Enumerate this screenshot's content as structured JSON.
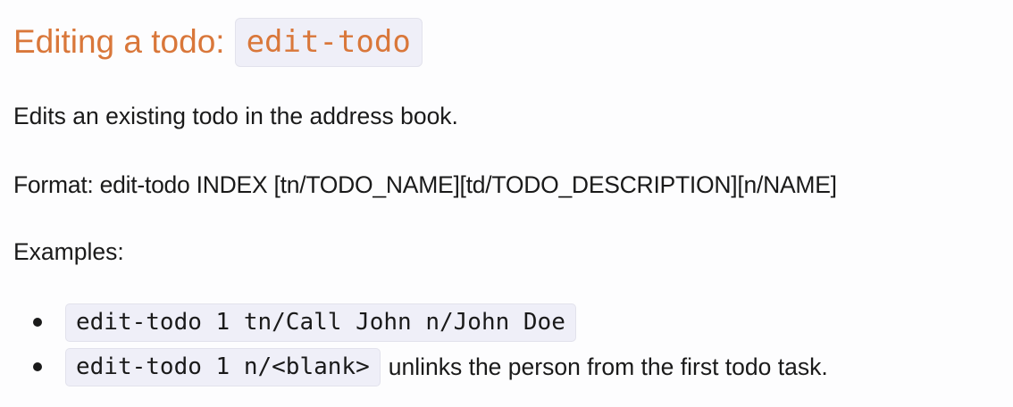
{
  "section": {
    "heading_text": "Editing a todo:",
    "heading_code": "edit-todo",
    "description": "Edits an existing todo in the address book.",
    "format": "Format: edit-todo INDEX [tn/TODO_NAME][td/TODO_DESCRIPTION][n/NAME]",
    "examples_label": "Examples:",
    "examples": [
      {
        "code": "edit-todo 1 tn/Call John n/John Doe",
        "text": ""
      },
      {
        "code": "edit-todo 1 n/<blank>",
        "text": "unlinks the person from the first todo task."
      }
    ]
  },
  "colors": {
    "heading": "#d9773a",
    "code_background": "#efeff8",
    "text": "#1a1a1a"
  }
}
